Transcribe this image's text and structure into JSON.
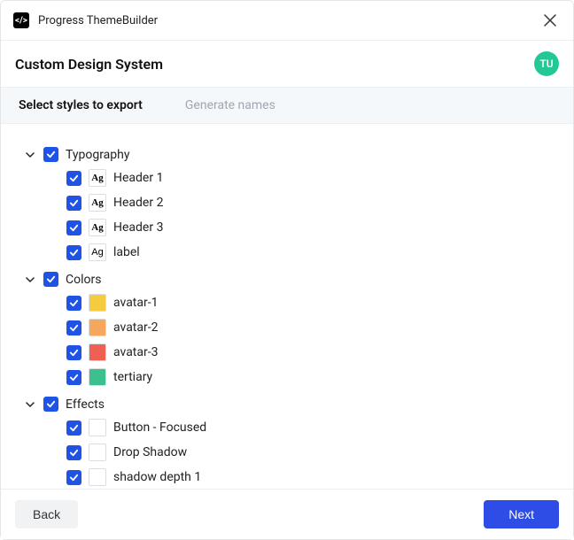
{
  "titlebar": {
    "title": "Progress ThemeBuilder",
    "icon_label": "</>"
  },
  "header": {
    "title": "Custom Design System",
    "avatar": "TU"
  },
  "tabs": {
    "select": "Select styles to export",
    "generate": "Generate names"
  },
  "colors": {
    "checkbox": "#1e53e5",
    "avatar_bg": "#22c997",
    "primary": "#2e4de6"
  },
  "tree": {
    "typography": {
      "label": "Typography",
      "items": [
        {
          "label": "Header 1",
          "swatch": "Ag",
          "style": "serif"
        },
        {
          "label": "Header 2",
          "swatch": "Ag",
          "style": "serif"
        },
        {
          "label": "Header 3",
          "swatch": "Ag",
          "style": "serif"
        },
        {
          "label": "label",
          "swatch": "Ag",
          "style": "plain"
        }
      ]
    },
    "colors_group": {
      "label": "Colors",
      "items": [
        {
          "label": "avatar-1",
          "color": "#f5cc3d"
        },
        {
          "label": "avatar-2",
          "color": "#f5a85b"
        },
        {
          "label": "avatar-3",
          "color": "#ef5f52"
        },
        {
          "label": "tertiary",
          "color": "#3cc08e"
        }
      ]
    },
    "effects": {
      "label": "Effects",
      "items": [
        {
          "label": "Button - Focused"
        },
        {
          "label": "Drop Shadow"
        },
        {
          "label": "shadow depth 1"
        }
      ]
    }
  },
  "footer": {
    "back": "Back",
    "next": "Next"
  }
}
